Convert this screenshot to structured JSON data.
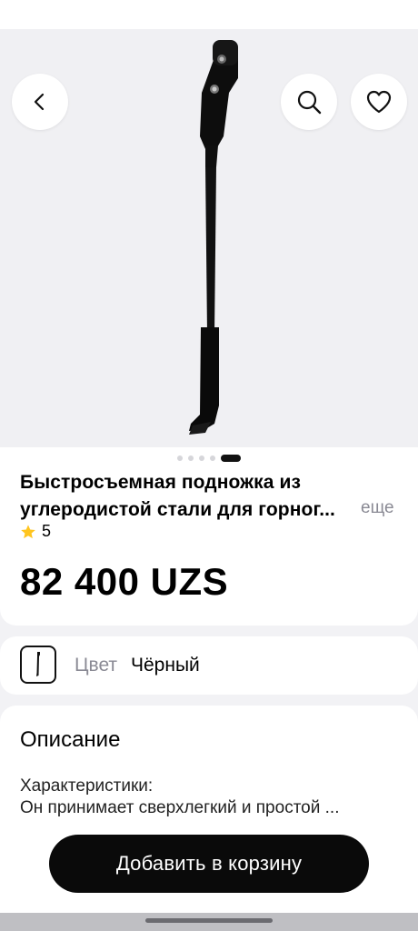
{
  "product": {
    "title_line1": "Быстросъемная подножка из",
    "title_line2": "углеродистой стали для горног...",
    "more_label": "еще",
    "rating": "5",
    "price": "82 400 UZS",
    "image_slides": 5,
    "active_slide": 5
  },
  "color": {
    "label": "Цвет",
    "value": "Чёрный"
  },
  "description": {
    "title": "Описание",
    "line1": "Характеристики:",
    "line2": "Он принимает сверхлегкий и простой ..."
  },
  "actions": {
    "add_to_cart": "Добавить в корзину"
  },
  "icons": {
    "back": "chevron-left-icon",
    "search": "search-icon",
    "favorite": "heart-icon",
    "rating": "star-icon"
  },
  "colors": {
    "accent": "#0a0a0a",
    "star": "#ffc51f",
    "muted_text": "#8a8a94"
  }
}
